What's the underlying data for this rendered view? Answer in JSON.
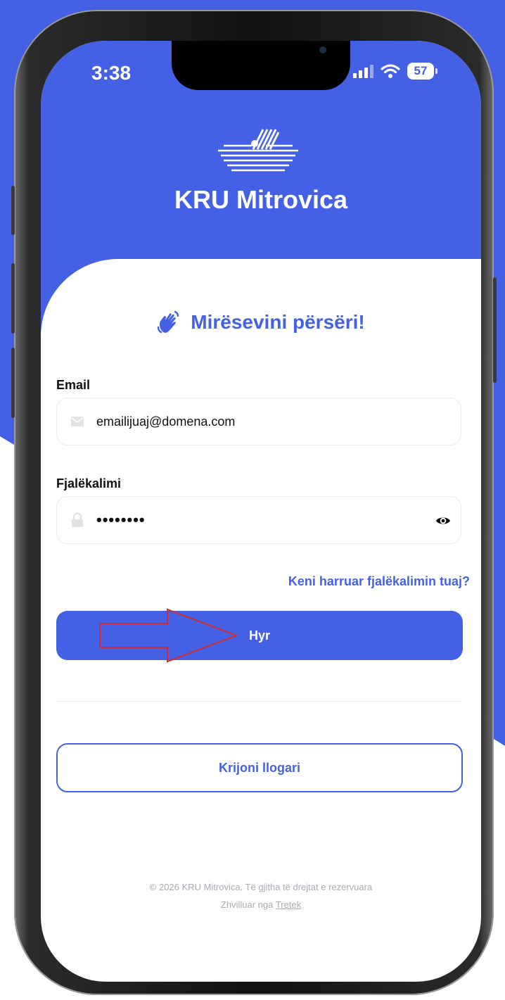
{
  "status_bar": {
    "time": "3:38",
    "battery": "57"
  },
  "header": {
    "brand": "KRU Mitrovica"
  },
  "welcome": {
    "title": "Mirësevini përsëri!"
  },
  "form": {
    "email_label": "Email",
    "email_value": "emailijuaj@domena.com",
    "password_label": "Fjalëkalimi",
    "password_value": "••••••••",
    "forgot_link": "Keni harruar fjalëkalimin tuaj?",
    "login_button": "Hyr"
  },
  "create_account_button": "Krijoni llogari",
  "footer": {
    "copyright": "© 2026 KRU Mitrovica. Të gjitha të drejtat e rezervuara",
    "developed_by_prefix": "Zhvilluar nga",
    "developer_link": "Tretek"
  },
  "colors": {
    "accent": "#4461e6",
    "background": "#ffffff",
    "muted": "#a9a9b3",
    "annotation_arrow": "#d12a2a"
  },
  "icons": [
    "logo-icon",
    "signal-icon",
    "wifi-icon",
    "battery-icon",
    "waving-hand-icon",
    "mail-icon",
    "lock-icon",
    "eye-icon",
    "annotation-arrow-icon"
  ]
}
